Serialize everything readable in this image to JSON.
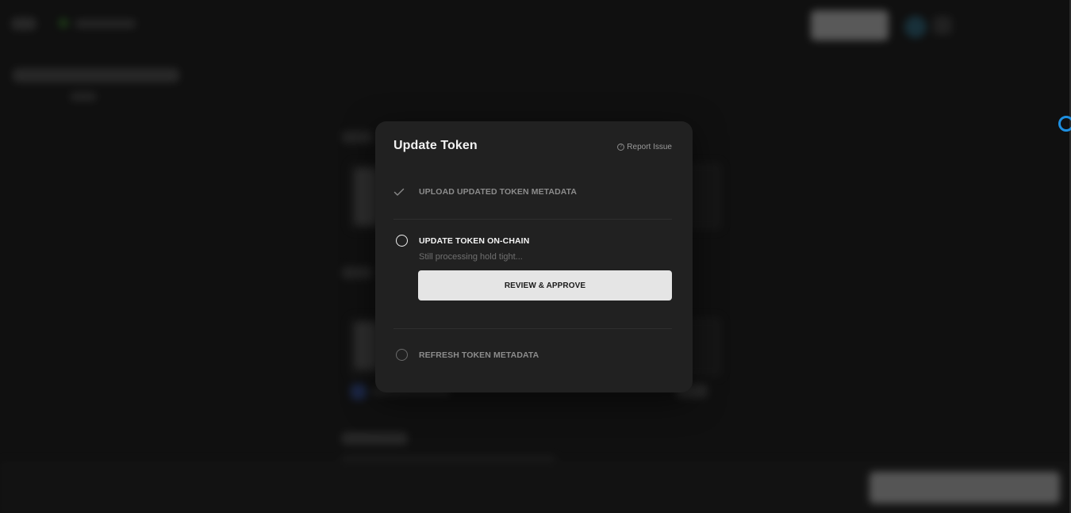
{
  "modal": {
    "title": "Update Token",
    "report_issue_label": "Report Issue",
    "report_issue_icon": "question-circle-icon",
    "steps": [
      {
        "label": "UPLOAD UPDATED TOKEN METADATA",
        "status": "completed",
        "icon": "checkmark-icon"
      },
      {
        "label": "UPDATE TOKEN ON-CHAIN",
        "status": "in-progress",
        "icon": "circle-outline-icon",
        "subtext": "Still processing hold tight...",
        "action_label": "REVIEW & APPROVE"
      },
      {
        "label": "REFRESH TOKEN METADATA",
        "status": "pending",
        "icon": "circle-outline-icon"
      }
    ]
  },
  "colors": {
    "background": "#141414",
    "modal_bg": "#212121",
    "button_bg": "#e5e5e5",
    "spinner_accent": "#1d8fe0"
  }
}
